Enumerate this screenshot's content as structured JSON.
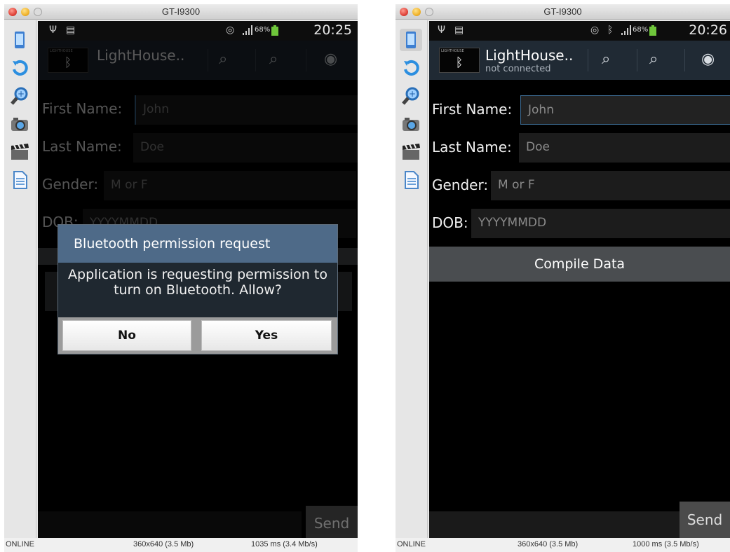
{
  "left": {
    "window_title": "GT-I9300",
    "status": {
      "battery_pct": "68%",
      "time": "20:25"
    },
    "app_name": "LightHouse..",
    "logo_text": "LIGHTHOUSE",
    "fields": [
      {
        "label": "First Name:",
        "value": "John"
      },
      {
        "label": "Last Name:",
        "value": "Doe"
      },
      {
        "label": "Gender:",
        "placeholder": "M or F"
      },
      {
        "label": "DOB:",
        "placeholder": "YYYYMMDD"
      }
    ],
    "send_label": "Send",
    "dialog": {
      "title": "Bluetooth permission request",
      "message": "Application is requesting permission to turn on Bluetooth. Allow?",
      "no_label": "No",
      "yes_label": "Yes"
    },
    "statusline": {
      "state": "ONLINE",
      "resolution": "360x640 (3.5 Mb)",
      "timing": "1035 ms (3.4 Mb/s)"
    }
  },
  "right": {
    "window_title": "GT-I9300",
    "status": {
      "battery_pct": "68%",
      "time": "20:26"
    },
    "app_name": "LightHouse..",
    "subtitle": "not connected",
    "logo_text": "LIGHTHOUSE",
    "fields": [
      {
        "label": "First Name:",
        "value": "John"
      },
      {
        "label": "Last Name:",
        "value": "Doe"
      },
      {
        "label": "Gender:",
        "placeholder": "M or F"
      },
      {
        "label": "DOB:",
        "placeholder": "YYYYMMDD"
      }
    ],
    "compile_label": "Compile Data",
    "send_label": "Send",
    "statusline": {
      "state": "ONLINE",
      "resolution": "360x640 (3.5 Mb)",
      "timing": "1000 ms (3.5 Mb/s)"
    }
  },
  "icons": {
    "usb": "Ψ",
    "signal": "signal-bars-icon",
    "bluetooth": "ᛒ",
    "search": "⌕",
    "target": "◉"
  }
}
